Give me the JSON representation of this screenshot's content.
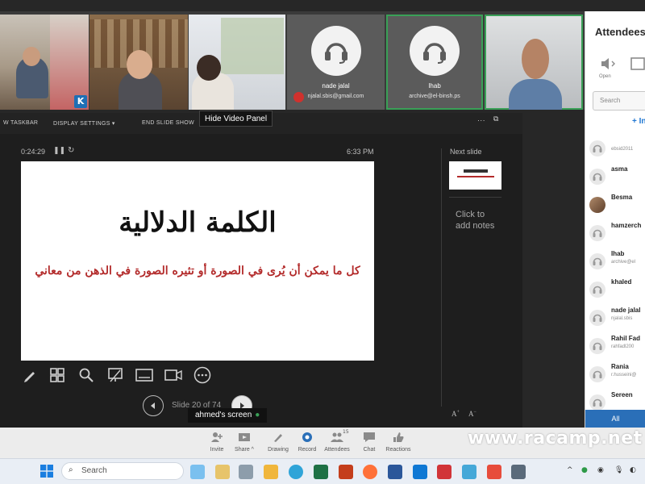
{
  "video_tiles": [
    {
      "name": "",
      "email": "",
      "kind": "photo"
    },
    {
      "name": "",
      "email": "",
      "kind": "photo"
    },
    {
      "name": "",
      "email": "",
      "kind": "photo"
    },
    {
      "name": "nade jalal",
      "email": "njalal.sbis@gmail.com",
      "kind": "avatar",
      "muted": true
    },
    {
      "name": "Ihab",
      "email": "archive@el-binsh.ps",
      "kind": "avatar",
      "active": true
    },
    {
      "name": "",
      "email": "",
      "kind": "photo",
      "active": true
    }
  ],
  "slide_toolbar": {
    "taskbar_label": "W TASKBAR",
    "display_settings": "DISPLAY SETTINGS ▾",
    "end_slide_show": "END SLIDE SHOW"
  },
  "tooltip": "Hide Video Panel",
  "presenter": {
    "timer": "0:24:29",
    "clock": "6:33 PM",
    "next_slide_label": "Next slide",
    "notes_placeholder": "Click to add notes",
    "slide_counter": "Slide 20 of 74",
    "screen_label": "ahmed's screen",
    "slide": {
      "title": "الكلمة الدلالية",
      "subtitle": "كل ما يمكن أن يُرى في الصورة أو تثيره الصورة في الذهن من معاني"
    },
    "tools": [
      "pen-icon",
      "slides-grid-icon",
      "zoom-icon",
      "pointer-icon",
      "subtitles-icon",
      "camera-icon",
      "more-icon"
    ]
  },
  "attendees_panel": {
    "title": "Attendees",
    "open_label": "Open",
    "search_placeholder": "Search",
    "add_label": "+ Invite",
    "tab_all": "All",
    "list": [
      {
        "name": "",
        "email": "ebsid2011",
        "photo": false
      },
      {
        "name": "asma",
        "email": "",
        "photo": false
      },
      {
        "name": "Besma",
        "email": "",
        "photo": true
      },
      {
        "name": "hamzerch",
        "email": "",
        "photo": false
      },
      {
        "name": "Ihab",
        "email": "archive@el",
        "photo": false
      },
      {
        "name": "khaled",
        "email": "",
        "photo": false
      },
      {
        "name": "nade jalal",
        "email": "njalal.sbis",
        "photo": false
      },
      {
        "name": "Rahil Fad",
        "email": "rahfadl200",
        "photo": false
      },
      {
        "name": "Rania",
        "email": "r.husseini@",
        "photo": false
      },
      {
        "name": "Sereen",
        "email": "",
        "photo": false
      }
    ]
  },
  "meeting_controls": [
    {
      "label": "Invite",
      "icon": "invite-icon"
    },
    {
      "label": "Share ^",
      "icon": "share-icon"
    },
    {
      "label": "Drawing",
      "icon": "drawing-icon"
    },
    {
      "label": "Record",
      "icon": "record-icon"
    },
    {
      "label": "Attendees",
      "icon": "attendees-icon",
      "count": "15"
    },
    {
      "label": "Chat",
      "icon": "chat-icon"
    },
    {
      "label": "Reactions",
      "icon": "reactions-icon"
    }
  ],
  "watermark": "www.racamp.net",
  "taskbar": {
    "search_placeholder": "Search",
    "apps": [
      "file-explorer",
      "browser",
      "outlook",
      "word",
      "excel",
      "powerpoint",
      "firefox",
      "acrobat",
      "chrome",
      "store"
    ]
  },
  "colors": {
    "accent_blue": "#2a6fb8",
    "active_green": "#3aa057",
    "mute_red": "#d0312d",
    "slide_subtitle_red": "#b32b2b"
  }
}
